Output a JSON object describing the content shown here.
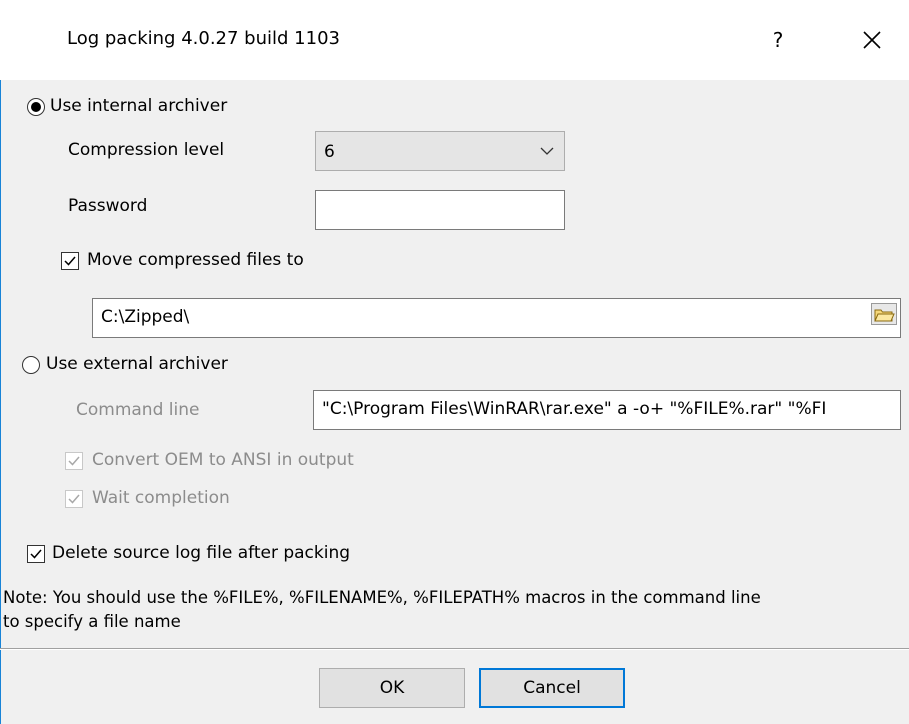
{
  "window": {
    "title": "Log packing 4.0.27 build 1103",
    "help_label": "?",
    "accent_color": "#1883d7"
  },
  "internal": {
    "radio_label": "Use internal archiver",
    "selected": true,
    "compression_label": "Compression level",
    "compression_value": "6",
    "password_label": "Password",
    "password_value": "",
    "move_label": "Move compressed files to",
    "move_checked": true,
    "move_path": "C:\\Zipped\\"
  },
  "external": {
    "radio_label": "Use external archiver",
    "selected": false,
    "command_label": "Command line",
    "command_value": "\"C:\\Program Files\\WinRAR\\rar.exe\" a -o+ \"%FILE%.rar\" \"%FI",
    "convert_label": "Convert OEM to ANSI in output",
    "convert_checked": true,
    "wait_label": "Wait completion",
    "wait_checked": true
  },
  "delete_label": "Delete source log file after packing",
  "delete_checked": true,
  "note_line1": "Note: You should use the %FILE%, %FILENAME%, %FILEPATH% macros in the command line",
  "note_line2": "to specify a file name",
  "buttons": {
    "ok": "OK",
    "cancel": "Cancel"
  },
  "icons": [
    "close-icon",
    "dropdown-chevron-icon",
    "folder-icon",
    "checkmark-icon"
  ]
}
